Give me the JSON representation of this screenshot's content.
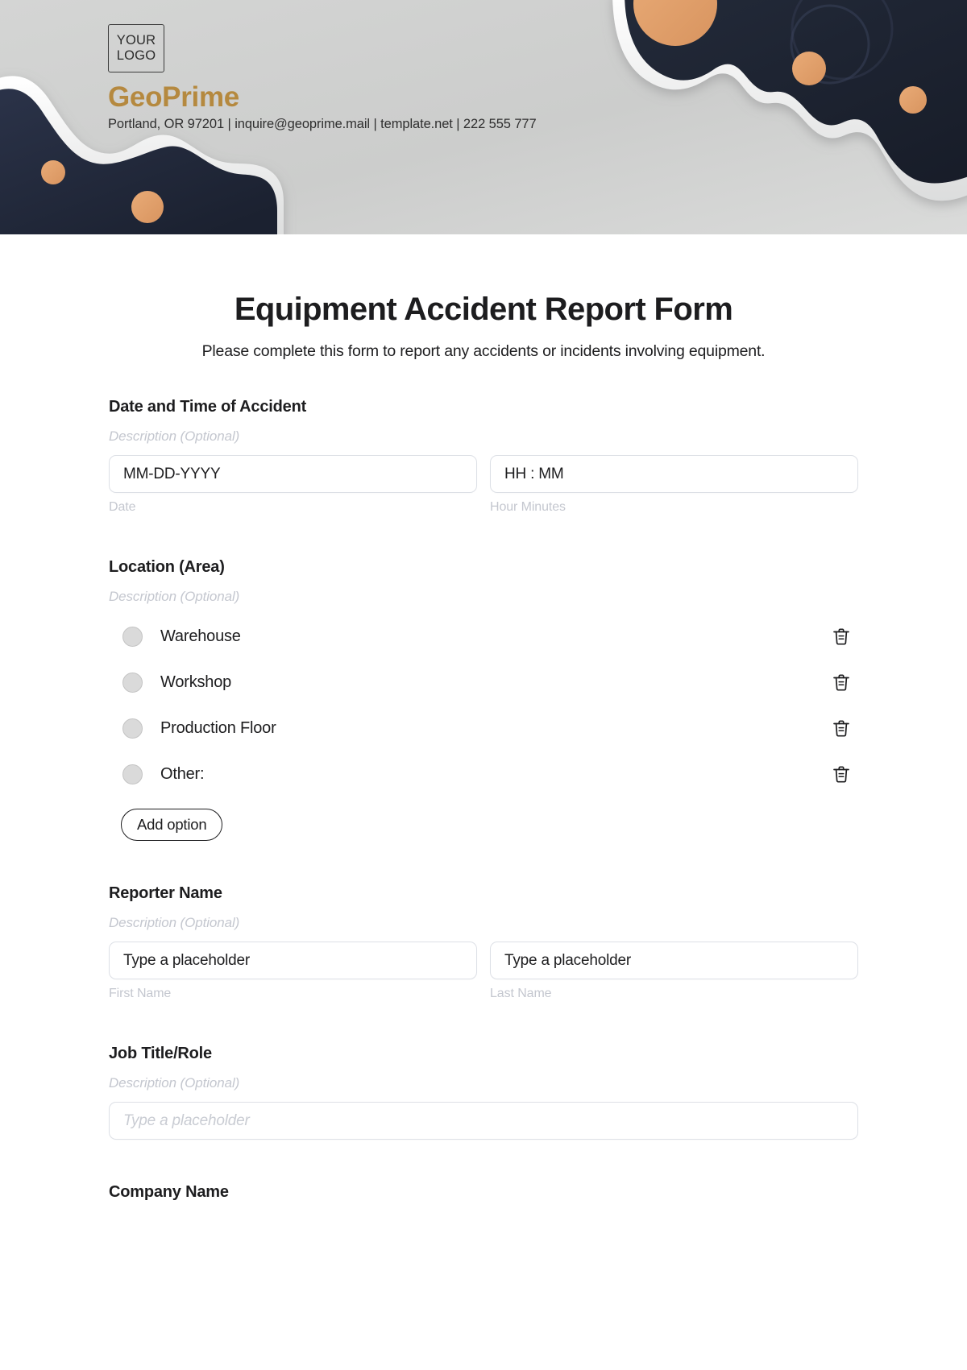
{
  "header": {
    "logo_line1": "YOUR",
    "logo_line2": "LOGO",
    "brand_name": "GeoPrime",
    "contact": "Portland, OR 97201 | inquire@geoprime.mail | template.net | 222 555 777",
    "accent_color": "#b5893f",
    "dark_color": "#242b3d",
    "dot_color": "#e0a170",
    "background_color": "#d2d3d3"
  },
  "form": {
    "title": "Equipment Accident Report Form",
    "subtitle": "Please complete this form to report any accidents or incidents involving equipment.",
    "sections": [
      {
        "label": "Date and Time of Accident",
        "description": "Description (Optional)",
        "inputs": [
          {
            "value": "MM-DD-YYYY",
            "caption": "Date"
          },
          {
            "value": "HH : MM",
            "caption": "Hour Minutes"
          }
        ]
      },
      {
        "label": "Location (Area)",
        "description": "Description (Optional)",
        "options": [
          {
            "label": "Warehouse",
            "delete_icon": "trash-icon"
          },
          {
            "label": "Workshop",
            "delete_icon": "trash-icon"
          },
          {
            "label": "Production Floor",
            "delete_icon": "trash-icon"
          },
          {
            "label": "Other:",
            "delete_icon": "trash-icon"
          }
        ],
        "add_option_label": "Add option"
      },
      {
        "label": "Reporter Name",
        "description": "Description (Optional)",
        "inputs": [
          {
            "value": "Type a placeholder",
            "caption": "First Name"
          },
          {
            "value": "Type a placeholder",
            "caption": "Last Name"
          }
        ]
      },
      {
        "label": "Job Title/Role",
        "description": "Description (Optional)",
        "inputs": [
          {
            "value": "Type a placeholder",
            "caption": ""
          }
        ]
      },
      {
        "label": "Company Name"
      }
    ]
  }
}
